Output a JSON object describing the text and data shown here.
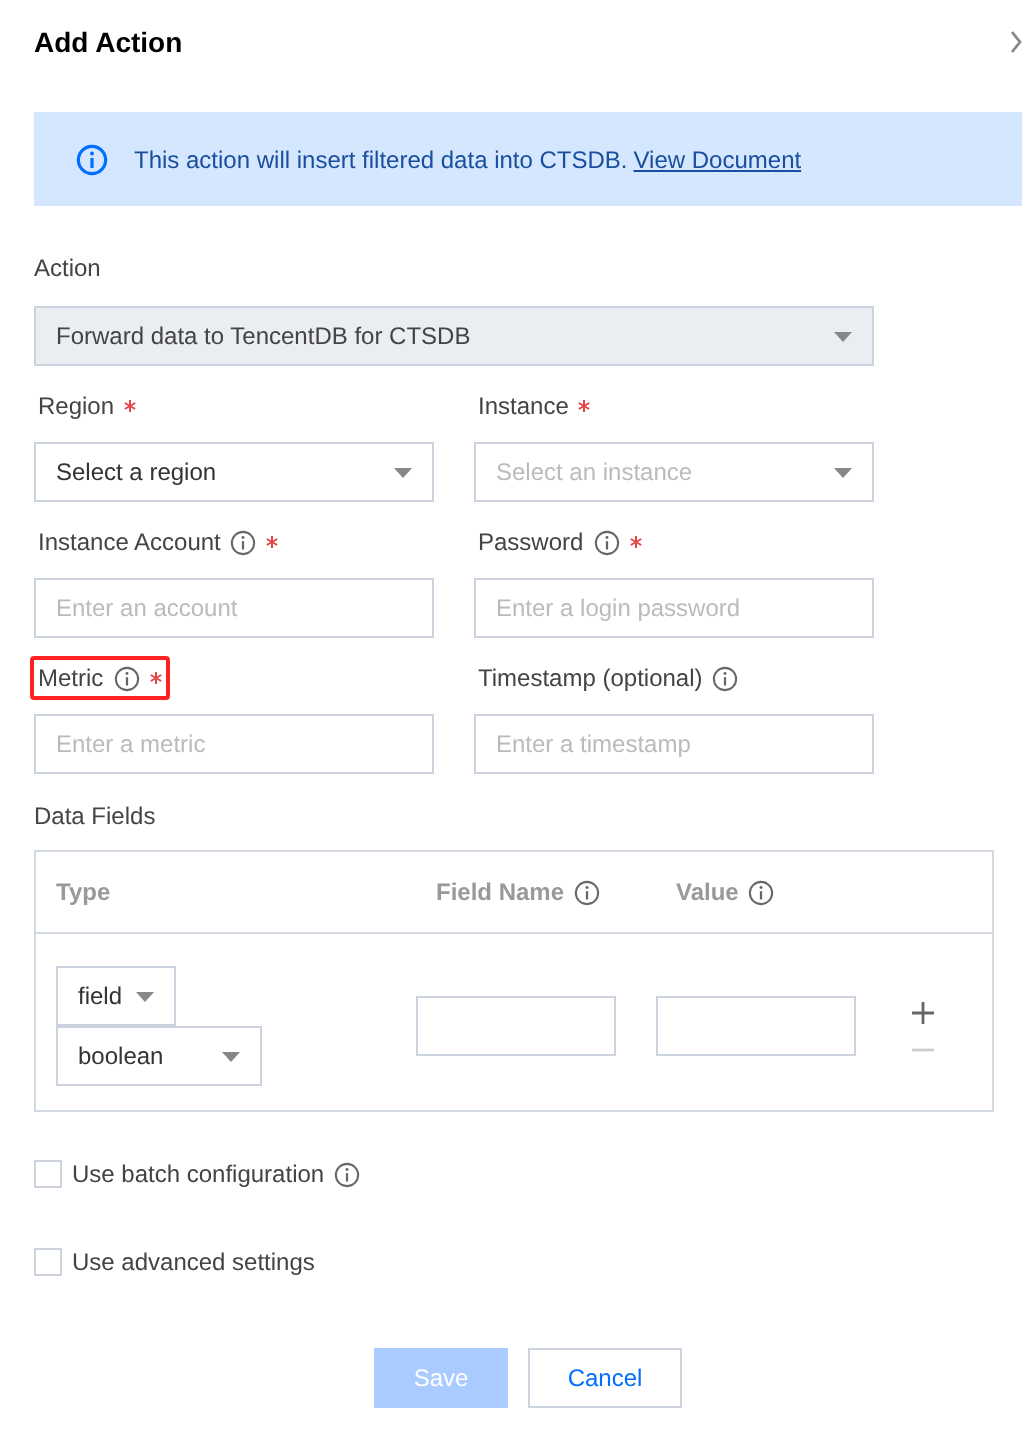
{
  "dialog": {
    "title": "Add Action"
  },
  "notice": {
    "text": "This action will insert filtered data into CTSDB.",
    "link": "View Document"
  },
  "action": {
    "label": "Action",
    "value": "Forward data to TencentDB for CTSDB",
    "disabled": true
  },
  "fields": [
    {
      "label": "Region",
      "kind": "select",
      "info": false,
      "required": true,
      "highlighted": false,
      "value": "Select a region"
    },
    {
      "label": "Instance",
      "kind": "select",
      "info": false,
      "required": true,
      "highlighted": false,
      "placeholder": "Select an instance"
    },
    {
      "label": "Instance Account",
      "kind": "input",
      "info": true,
      "required": true,
      "highlighted": false,
      "placeholder": "Enter an account"
    },
    {
      "label": "Password",
      "kind": "input",
      "info": true,
      "required": true,
      "highlighted": false,
      "placeholder": "Enter a login password"
    },
    {
      "label": "Metric",
      "kind": "input",
      "info": true,
      "required": true,
      "highlighted": true,
      "placeholder": "Enter a metric"
    },
    {
      "label": "Timestamp (optional)",
      "kind": "input",
      "info": true,
      "required": false,
      "highlighted": false,
      "placeholder": "Enter a timestamp"
    }
  ],
  "data_fields": {
    "label": "Data Fields",
    "columns": [
      {
        "label": "Type",
        "info": false
      },
      {
        "label": "Field Name",
        "info": true
      },
      {
        "label": "Value",
        "info": true
      }
    ],
    "rows": [
      {
        "type": "field",
        "subtype": "boolean",
        "remove_disabled": true
      }
    ]
  },
  "options": [
    {
      "label": "Use batch configuration",
      "info": true,
      "checked": false
    },
    {
      "label": "Use advanced settings",
      "info": false,
      "checked": false
    }
  ],
  "buttons": [
    {
      "label": "Save",
      "kind": "primary",
      "disabled": true
    },
    {
      "label": "Cancel",
      "kind": "default",
      "disabled": false
    }
  ]
}
